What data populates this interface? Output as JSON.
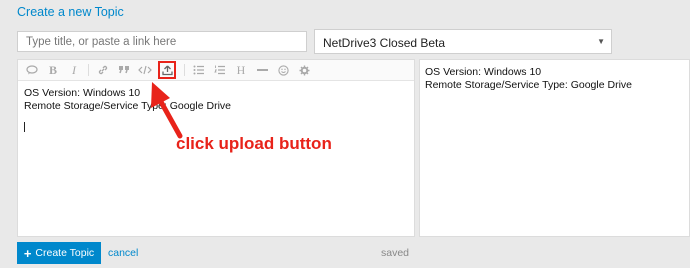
{
  "header": {
    "title": "Create a new Topic"
  },
  "title_input": {
    "value": "",
    "placeholder": "Type title, or paste a link here"
  },
  "category": {
    "selected": "NetDrive3 Closed Beta"
  },
  "toolbar": {
    "icons": [
      "quote-icon",
      "bold-icon",
      "italic-icon",
      "link-icon",
      "blockquote-icon",
      "code-icon",
      "upload-icon",
      "bullet-list-icon",
      "numbered-list-icon",
      "heading-icon",
      "horizontal-rule-icon",
      "emoji-icon",
      "gear-icon"
    ],
    "bold_glyph": "B",
    "italic_glyph": "I",
    "heading_glyph": "H"
  },
  "editor": {
    "line1": "OS Version: Windows 10",
    "line2": "Remote Storage/Service Type: Google Drive"
  },
  "preview": {
    "line1": "OS Version: Windows 10",
    "line2": "Remote Storage/Service Type: Google Drive"
  },
  "annotation": {
    "text": "click upload button",
    "color": "#e8231a"
  },
  "footer": {
    "create_label": "Create Topic",
    "cancel_label": "cancel",
    "status": "saved"
  },
  "colors": {
    "accent": "#0088cc",
    "background": "#e9e9e9"
  }
}
